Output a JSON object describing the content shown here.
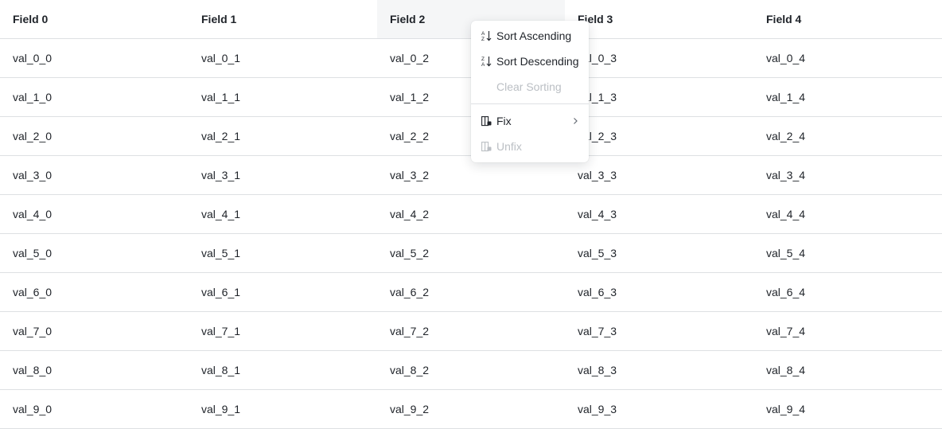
{
  "table": {
    "headers": [
      "Field 0",
      "Field 1",
      "Field 2",
      "Field 3",
      "Field 4"
    ],
    "rows": [
      [
        "val_0_0",
        "val_0_1",
        "val_0_2",
        "val_0_3",
        "val_0_4"
      ],
      [
        "val_1_0",
        "val_1_1",
        "val_1_2",
        "val_1_3",
        "val_1_4"
      ],
      [
        "val_2_0",
        "val_2_1",
        "val_2_2",
        "val_2_3",
        "val_2_4"
      ],
      [
        "val_3_0",
        "val_3_1",
        "val_3_2",
        "val_3_3",
        "val_3_4"
      ],
      [
        "val_4_0",
        "val_4_1",
        "val_4_2",
        "val_4_3",
        "val_4_4"
      ],
      [
        "val_5_0",
        "val_5_1",
        "val_5_2",
        "val_5_3",
        "val_5_4"
      ],
      [
        "val_6_0",
        "val_6_1",
        "val_6_2",
        "val_6_3",
        "val_6_4"
      ],
      [
        "val_7_0",
        "val_7_1",
        "val_7_2",
        "val_7_3",
        "val_7_4"
      ],
      [
        "val_8_0",
        "val_8_1",
        "val_8_2",
        "val_8_3",
        "val_8_4"
      ],
      [
        "val_9_0",
        "val_9_1",
        "val_9_2",
        "val_9_3",
        "val_9_4"
      ]
    ]
  },
  "context_menu": {
    "sort_ascending": "Sort Ascending",
    "sort_descending": "Sort Descending",
    "clear_sorting": "Clear Sorting",
    "fix": "Fix",
    "unfix": "Unfix",
    "icons": {
      "sort_ascending": "sort-ascending-icon",
      "sort_descending": "sort-descending-icon",
      "fix": "pin-column-icon",
      "unfix": "unpin-column-icon",
      "submenu": "chevron-right-icon"
    }
  },
  "colors": {
    "text": "#1f2329",
    "disabled_text": "#bbbfc4",
    "border": "#dee0e3",
    "active_header_bg": "#f5f6f7"
  }
}
